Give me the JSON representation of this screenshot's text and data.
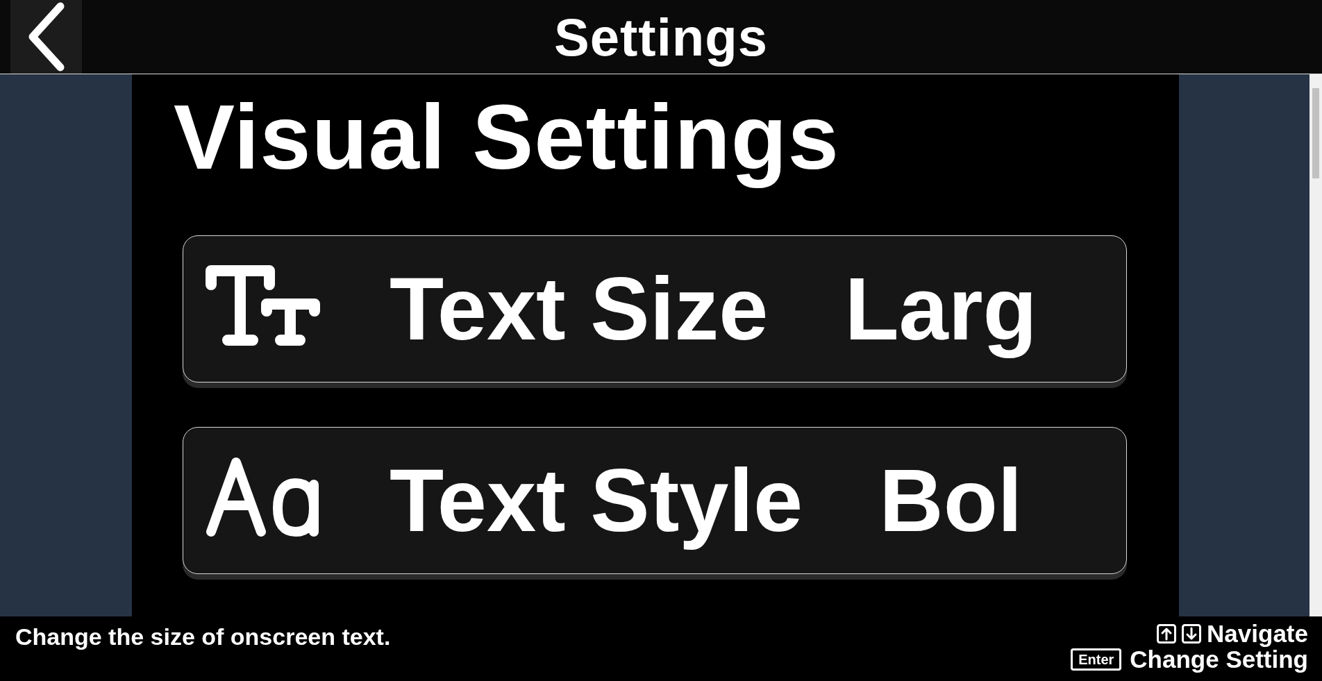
{
  "header": {
    "title": "Settings"
  },
  "section": {
    "title": "Visual Settings"
  },
  "settings": [
    {
      "kind": "text-size",
      "label": "Text Size",
      "value": "Larg"
    },
    {
      "kind": "text-style",
      "label": "Text Style",
      "value": "Bol"
    }
  ],
  "footer": {
    "hint": "Change the size of onscreen text.",
    "controls": [
      {
        "kind": "arrows",
        "label": "Navigate"
      },
      {
        "kind": "enter",
        "key": "Enter",
        "label": "Change Setting"
      }
    ]
  }
}
